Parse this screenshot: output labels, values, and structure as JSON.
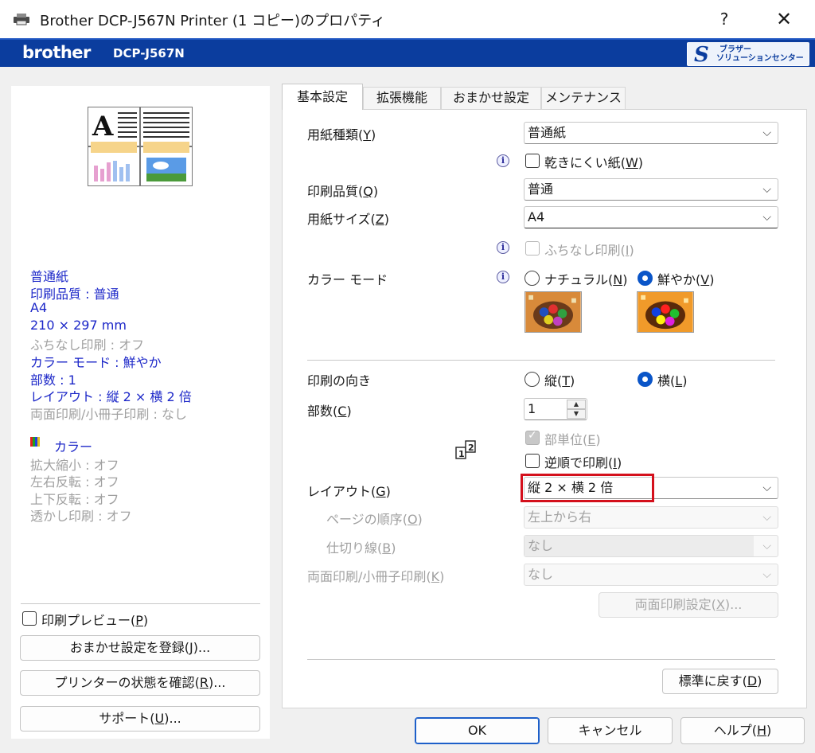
{
  "window": {
    "title": "Brother DCP-J567N Printer (1 コピー)のプロパティ",
    "help": "?",
    "close": "✕"
  },
  "brand": {
    "logo": "brother",
    "model": "DCP-J567N",
    "solution_line1": "ブラザー",
    "solution_line2": "ソリューションセンター"
  },
  "summary": {
    "media": "普通紙",
    "quality": "印刷品質 : 普通",
    "size": "A4",
    "dimensions": "210 × 297 mm",
    "borderless": "ふちなし印刷 : オフ",
    "color_mode": "カラー モード : 鮮やか",
    "copies": "部数 : 1",
    "layout": "レイアウト : 縦 2 × 横 2 倍",
    "duplex": "両面印刷/小冊子印刷 : なし",
    "color": "カラー",
    "scaling": "拡大縮小 : オフ",
    "mirror_lr": "左右反転 : オフ",
    "mirror_ud": "上下反転 : オフ",
    "watermark": "透かし印刷 : オフ"
  },
  "left": {
    "preview_label": "印刷プレビュー",
    "preview_key": "P",
    "register_label": "おまかせ設定を登録",
    "register_key": "J",
    "status_label": "プリンターの状態を確認",
    "status_key": "R",
    "support_label": "サポート",
    "support_key": "U",
    "ellipsis": "..."
  },
  "tabs": [
    "基本設定",
    "拡張機能",
    "おまかせ設定",
    "メンテナンス"
  ],
  "form": {
    "media_type": {
      "label": "用紙種類",
      "key": "Y",
      "value": "普通紙"
    },
    "slow_dry": {
      "label": "乾きにくい紙",
      "key": "W"
    },
    "quality": {
      "label": "印刷品質",
      "key": "Q",
      "value": "普通"
    },
    "paper_size": {
      "label": "用紙サイズ",
      "key": "Z",
      "value": "A4"
    },
    "borderless": {
      "label": "ふちなし印刷",
      "key": "I"
    },
    "color_mode": {
      "label": "カラー モード",
      "natural": "ナチュラル",
      "natural_key": "N",
      "vivid": "鮮やか",
      "vivid_key": "V"
    },
    "orientation": {
      "label": "印刷の向き",
      "portrait": "縦",
      "portrait_key": "T",
      "landscape": "横",
      "landscape_key": "L"
    },
    "copies": {
      "label": "部数",
      "key": "C",
      "value": "1"
    },
    "collate": {
      "label": "部単位",
      "key": "E"
    },
    "reverse": {
      "label": "逆順で印刷",
      "key": "I"
    },
    "layout": {
      "label": "レイアウト",
      "key": "G",
      "value": "縦 2 × 横 2 倍"
    },
    "page_order": {
      "label": "ページの順序",
      "key": "O",
      "value": "左上から右"
    },
    "border_line": {
      "label": "仕切り線",
      "key": "B",
      "value": "なし"
    },
    "duplex": {
      "label": "両面印刷/小冊子印刷",
      "key": "K",
      "value": "なし"
    },
    "duplex_settings": {
      "label": "両面印刷設定",
      "key": "X"
    },
    "defaults": {
      "label": "標準に戻す",
      "key": "D"
    }
  },
  "footer": {
    "ok": "OK",
    "cancel": "キャンセル",
    "help": "ヘルプ",
    "help_key": "H"
  },
  "colors": {
    "brand_blue": "#0b3d9e",
    "summary_blue": "#1c27c8",
    "highlight_red": "#d4101c",
    "radio_blue": "#0a55c8"
  }
}
